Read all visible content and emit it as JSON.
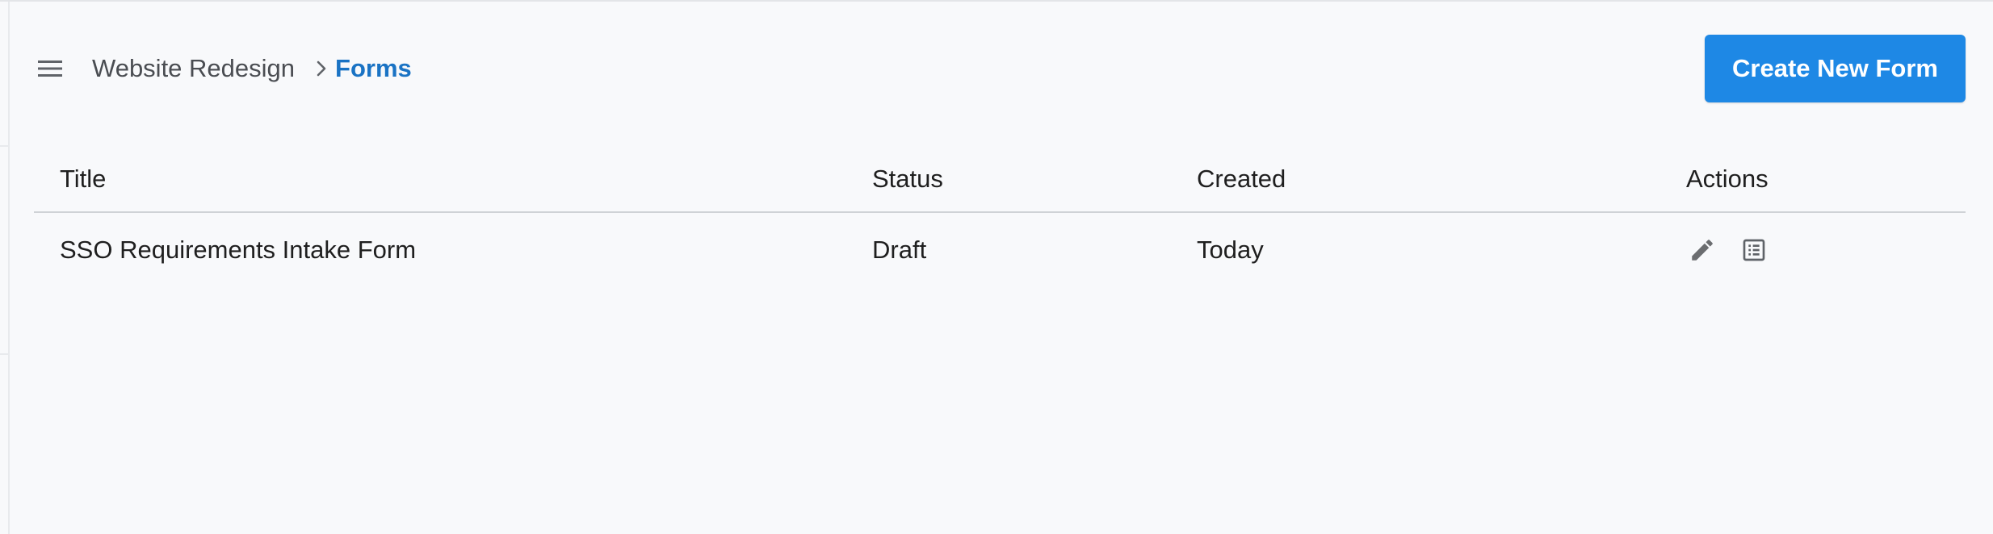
{
  "breadcrumb": {
    "parent": "Website Redesign",
    "current": "Forms"
  },
  "toolbar": {
    "create_label": "Create New Form"
  },
  "table": {
    "headers": {
      "title": "Title",
      "status": "Status",
      "created": "Created",
      "actions": "Actions"
    },
    "rows": [
      {
        "title": "SSO Requirements Intake Form",
        "status": "Draft",
        "created": "Today"
      }
    ]
  },
  "icons": {
    "menu": "hamburger-menu-icon",
    "separator": "chevron-right-icon",
    "edit": "pencil-icon",
    "view": "list-alt-icon"
  },
  "colors": {
    "accent": "#1e88e5",
    "breadcrumb_current": "#1a73c4",
    "icon": "#6b6d70",
    "background": "#f8f9fb"
  }
}
